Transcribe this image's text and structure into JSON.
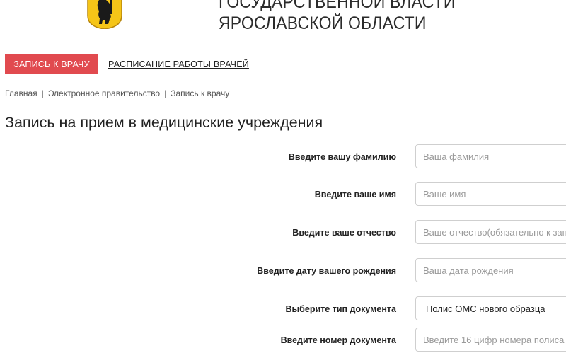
{
  "header": {
    "title_line1": "ГОСУДАРСТВЕННОЙ ВЛАСТИ",
    "title_line2": "ЯРОСЛАВСКОЙ ОБЛАСТИ",
    "coat_colors": {
      "shield": "#f5c518",
      "bear": "#1a1a1a",
      "outline": "#b8860b"
    }
  },
  "tabs": {
    "active": "ЗАПИСЬ К ВРАЧУ",
    "schedule": "РАСПИСАНИЕ РАБОТЫ ВРАЧЕЙ"
  },
  "breadcrumb": {
    "items": [
      "Главная",
      "Электронное правительство",
      "Запись к врачу"
    ],
    "separator": "|"
  },
  "page_title": "Запись на прием в медицинские учреждения",
  "form": {
    "surname_label": "Введите вашу фамилию",
    "surname_placeholder": "Ваша фамилия",
    "name_label": "Введите ваше имя",
    "name_placeholder": "Ваше имя",
    "patronymic_label": "Введите ваше отчество",
    "patronymic_placeholder": "Ваше отчество(обязательно к заполнению)",
    "birthdate_label": "Введите дату вашего рождения",
    "birthdate_placeholder": "Ваша дата рождения",
    "doctype_label": "Выберите тип документа",
    "doctype_value": "Полис ОМС нового образца",
    "docnum_label": "Введите номер документа",
    "docnum_placeholder": "Введите 16 цифр номера полиса"
  },
  "colors": {
    "accent": "#e14a4f",
    "border": "#cfcfcf",
    "placeholder": "#9a9a9a"
  }
}
